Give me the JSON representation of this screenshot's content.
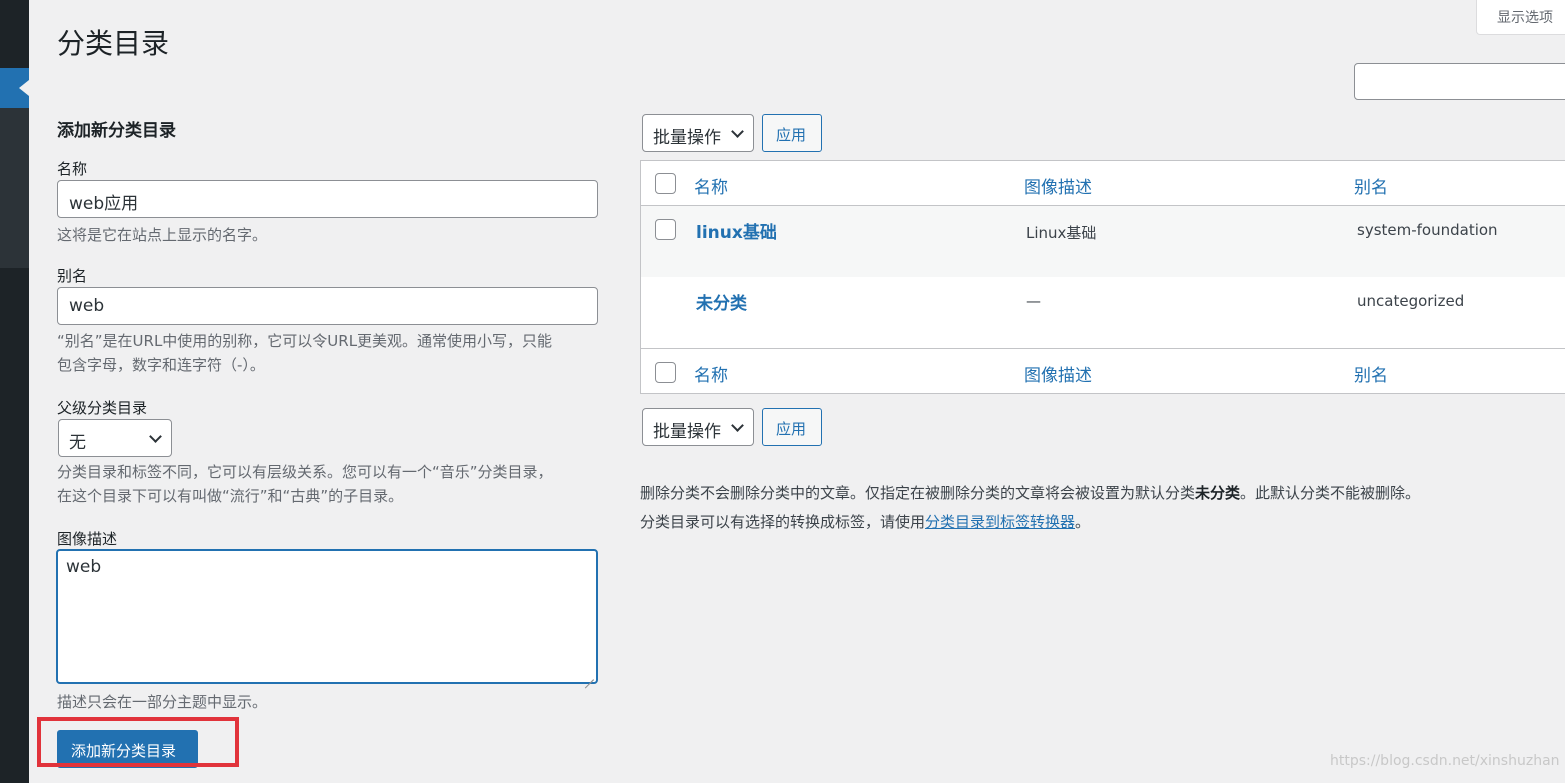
{
  "screen_options": "显示选项",
  "page_title": "分类目录",
  "add_form": {
    "heading": "添加新分类目录",
    "name_label": "名称",
    "name_value": "web应用",
    "name_help": "这将是它在站点上显示的名字。",
    "slug_label": "别名",
    "slug_value": "web",
    "slug_help_line1": "“别名”是在URL中使用的别称，它可以令URL更美观。通常使用小写，只能",
    "slug_help_line2": "包含字母，数字和连字符（-）。",
    "parent_label": "父级分类目录",
    "parent_value": "无",
    "parent_help_line1": "分类目录和标签不同，它可以有层级关系。您可以有一个“音乐”分类目录，",
    "parent_help_line2": "在这个目录下可以有叫做“流行”和“古典”的子目录。",
    "desc_label": "图像描述",
    "desc_value": "web",
    "desc_help": "描述只会在一部分主题中显示。",
    "submit_label": "添加新分类目录"
  },
  "bulk": {
    "select_label": "批量操作",
    "apply_label": "应用"
  },
  "table": {
    "columns": [
      "名称",
      "图像描述",
      "别名"
    ],
    "rows": [
      {
        "name": "linux基础",
        "description": "Linux基础",
        "slug": "system-foundation"
      },
      {
        "name": "未分类",
        "description": "—",
        "slug": "uncategorized"
      }
    ]
  },
  "notes": {
    "line1_pre": "删除分类不会删除分类中的文章。仅指定在被删除分类的文章将会被设置为默认分类",
    "line1_bold": "未分类",
    "line1_post": "。此默认分类不能被删除。",
    "line2_pre": "分类目录可以有选择的转换成标签，请使用",
    "line2_link": "分类目录到标签转换器",
    "line2_post": "。"
  },
  "watermark": "https://blog.csdn.net/xinshuzhan",
  "colors": {
    "accent": "#2271b1",
    "highlight_box": "#e1333b",
    "admin_sidebar": "#1d2327"
  }
}
